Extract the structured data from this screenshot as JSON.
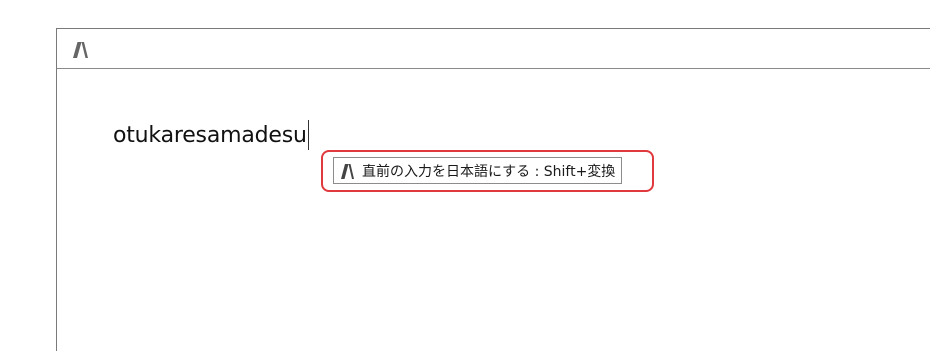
{
  "app": {
    "logo_icon": "atok-logo-icon"
  },
  "editor": {
    "typed_text": "otukaresamadesu"
  },
  "suggestion": {
    "icon": "atok-logo-icon",
    "text": "直前の入力を日本語にする : Shift+変換"
  },
  "colors": {
    "highlight": "#e0393e",
    "border": "#7a7a7a"
  }
}
